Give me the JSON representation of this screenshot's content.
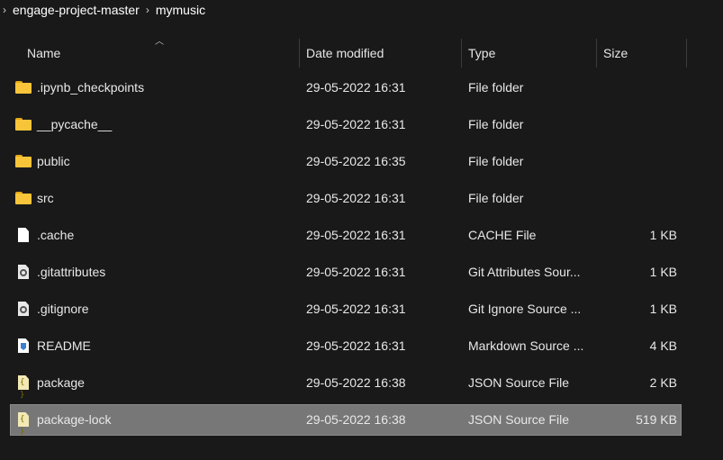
{
  "breadcrumb": {
    "items": [
      "engage-project-master",
      "mymusic"
    ]
  },
  "columns": {
    "name": "Name",
    "date": "Date modified",
    "type": "Type",
    "size": "Size"
  },
  "files": [
    {
      "name": ".ipynb_checkpoints",
      "date": "29-05-2022 16:31",
      "type": "File folder",
      "size": "",
      "icon": "folder-icon"
    },
    {
      "name": "__pycache__",
      "date": "29-05-2022 16:31",
      "type": "File folder",
      "size": "",
      "icon": "folder-icon"
    },
    {
      "name": "public",
      "date": "29-05-2022 16:35",
      "type": "File folder",
      "size": "",
      "icon": "folder-icon"
    },
    {
      "name": "src",
      "date": "29-05-2022 16:31",
      "type": "File folder",
      "size": "",
      "icon": "folder-icon"
    },
    {
      "name": ".cache",
      "date": "29-05-2022 16:31",
      "type": "CACHE File",
      "size": "1 KB",
      "icon": "file-icon"
    },
    {
      "name": ".gitattributes",
      "date": "29-05-2022 16:31",
      "type": "Git Attributes Sour...",
      "size": "1 KB",
      "icon": "settings-file-icon"
    },
    {
      "name": ".gitignore",
      "date": "29-05-2022 16:31",
      "type": "Git Ignore Source ...",
      "size": "1 KB",
      "icon": "settings-file-icon"
    },
    {
      "name": "README",
      "date": "29-05-2022 16:31",
      "type": "Markdown Source ...",
      "size": "4 KB",
      "icon": "markdown-file-icon"
    },
    {
      "name": "package",
      "date": "29-05-2022 16:38",
      "type": "JSON Source File",
      "size": "2 KB",
      "icon": "json-file-icon"
    },
    {
      "name": "package-lock",
      "date": "29-05-2022 16:38",
      "type": "JSON Source File",
      "size": "519 KB",
      "icon": "json-file-icon",
      "selected": true
    }
  ]
}
